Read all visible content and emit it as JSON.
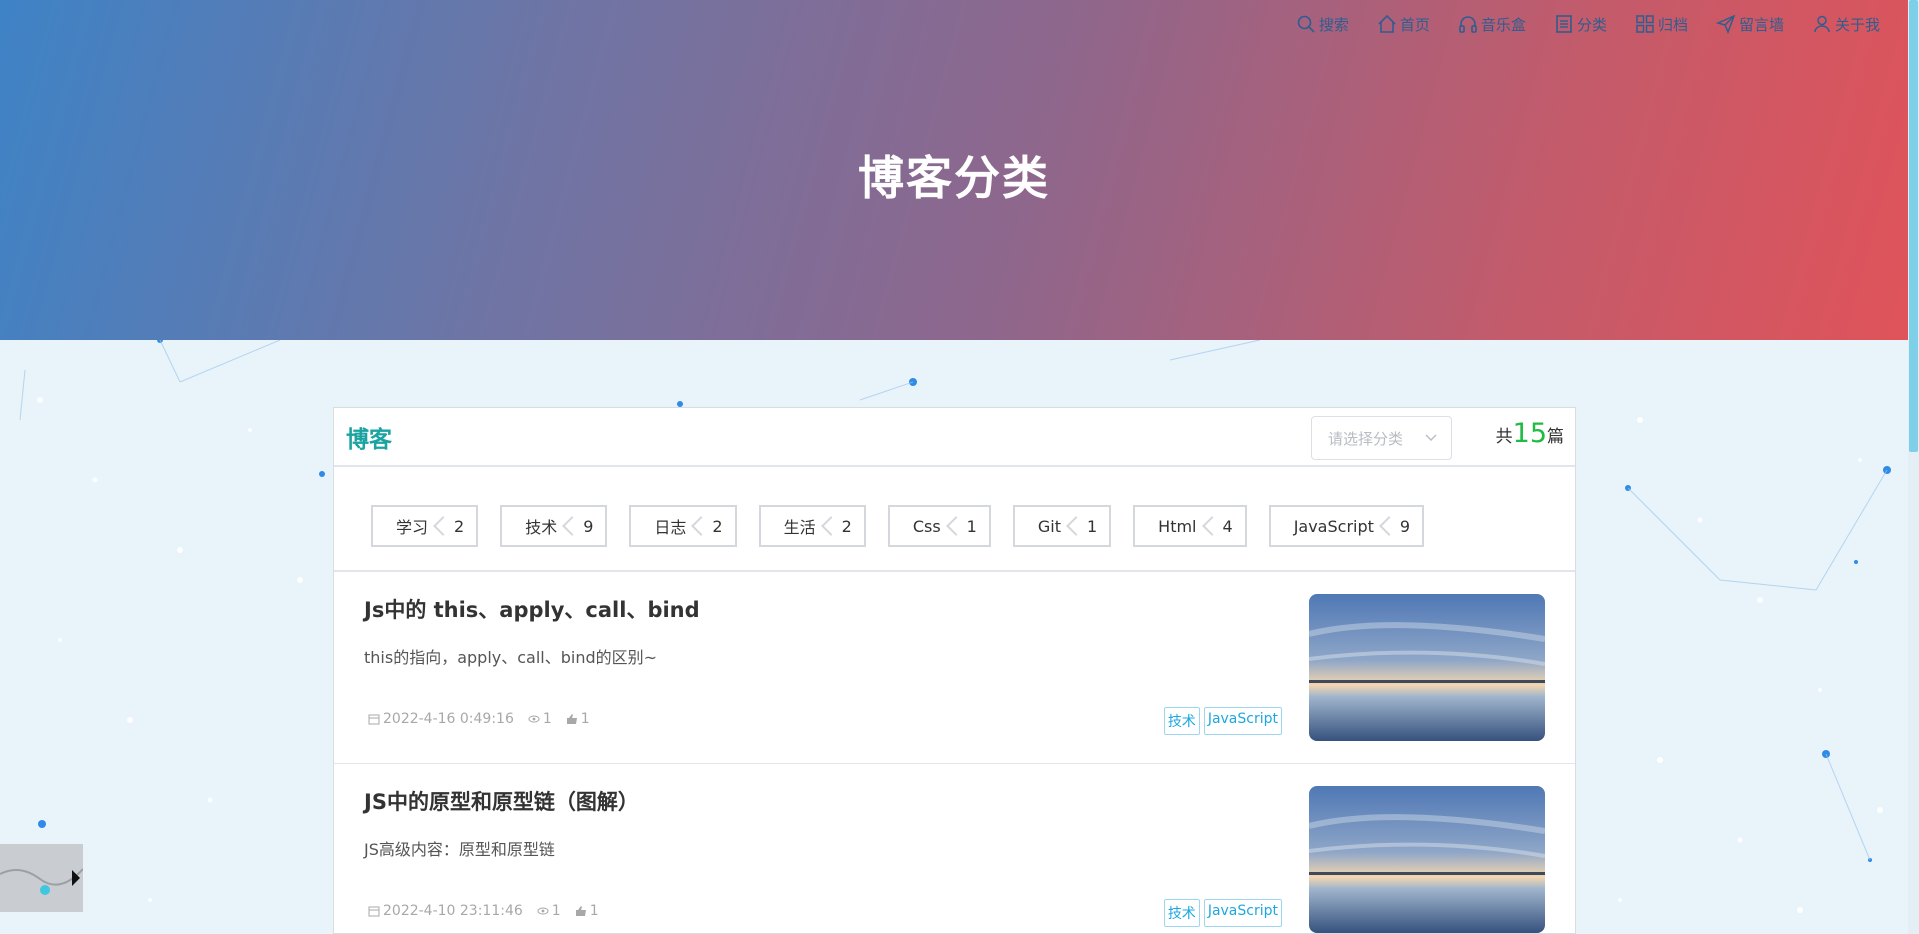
{
  "nav": {
    "items": [
      {
        "label": "搜索",
        "icon": "search-icon"
      },
      {
        "label": "首页",
        "icon": "home-icon"
      },
      {
        "label": "音乐盒",
        "icon": "headphones-icon"
      },
      {
        "label": "分类",
        "icon": "document-icon"
      },
      {
        "label": "归档",
        "icon": "grid-icon"
      },
      {
        "label": "留言墙",
        "icon": "send-icon"
      },
      {
        "label": "关于我",
        "icon": "user-icon"
      }
    ]
  },
  "hero": {
    "title": "博客分类"
  },
  "panel": {
    "title": "博客",
    "select_placeholder": "请选择分类",
    "total_prefix": "共",
    "total_count": "15",
    "total_suffix": "篇"
  },
  "categories": [
    {
      "name": "学习",
      "count": "2"
    },
    {
      "name": "技术",
      "count": "9"
    },
    {
      "name": "日志",
      "count": "2"
    },
    {
      "name": "生活",
      "count": "2"
    },
    {
      "name": "Css",
      "count": "1"
    },
    {
      "name": "Git",
      "count": "1"
    },
    {
      "name": "Html",
      "count": "4"
    },
    {
      "name": "JavaScript",
      "count": "9"
    }
  ],
  "posts": [
    {
      "title": "Js中的 this、apply、call、bind",
      "desc": "this的指向，apply、call、bind的区别~",
      "date": "2022-4-16 0:49:16",
      "views": "1",
      "likes": "1",
      "labels": [
        "技术",
        "JavaScript"
      ]
    },
    {
      "title": "JS中的原型和原型链（图解）",
      "desc": "JS高级内容：原型和原型链",
      "date": "2022-4-10 23:11:46",
      "views": "1",
      "likes": "1",
      "labels": [
        "技术",
        "JavaScript"
      ]
    }
  ],
  "colors": {
    "accent_teal": "#1aa3a0",
    "count_green": "#21ba45",
    "label_blue": "#1ea7e0"
  }
}
